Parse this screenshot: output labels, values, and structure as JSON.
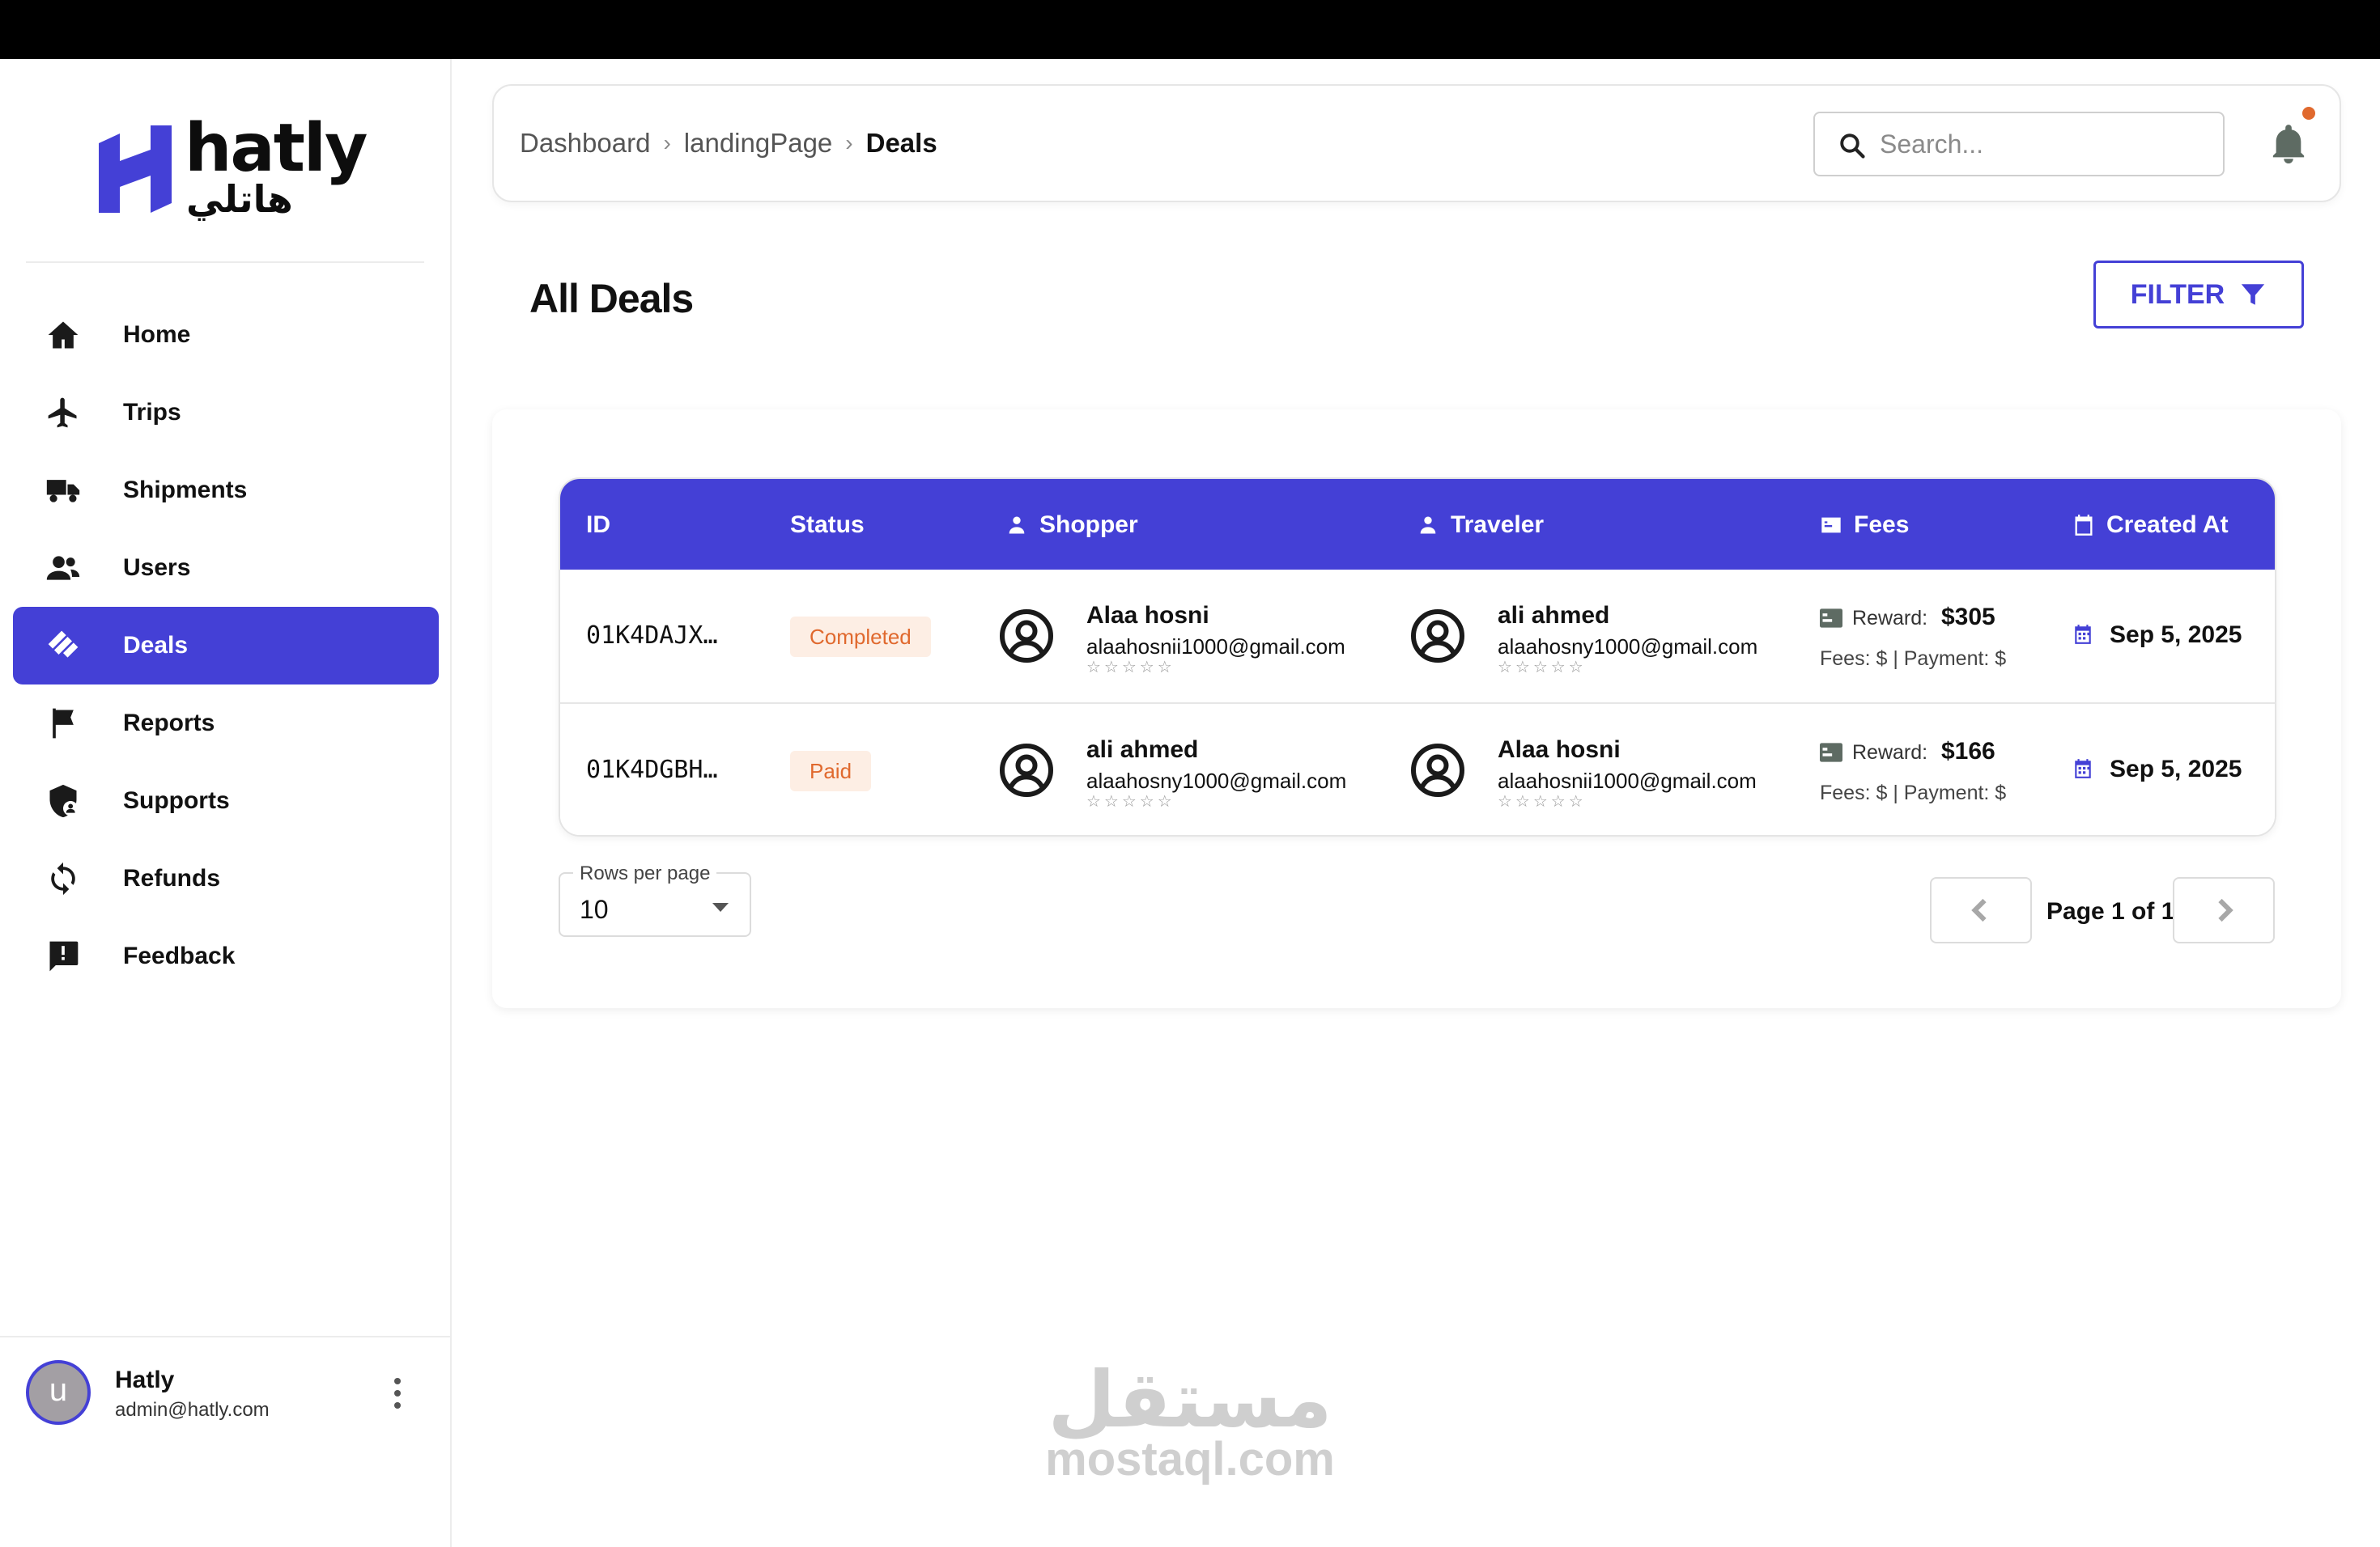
{
  "brand": {
    "name": "hatly",
    "arabic_name": "هاتلي",
    "accent_color": "#4440d6"
  },
  "sidebar": {
    "items": [
      {
        "label": "Home",
        "icon": "home-icon"
      },
      {
        "label": "Trips",
        "icon": "airplane-icon"
      },
      {
        "label": "Shipments",
        "icon": "truck-icon"
      },
      {
        "label": "Users",
        "icon": "users-icon"
      },
      {
        "label": "Deals",
        "icon": "handshake-icon",
        "active": true
      },
      {
        "label": "Reports",
        "icon": "flag-icon"
      },
      {
        "label": "Supports",
        "icon": "shield-user-icon"
      },
      {
        "label": "Refunds",
        "icon": "refresh-icon"
      },
      {
        "label": "Feedback",
        "icon": "feedback-icon"
      }
    ],
    "user": {
      "avatar_letter": "u",
      "name": "Hatly",
      "email": "admin@hatly.com"
    }
  },
  "header": {
    "breadcrumb": [
      "Dashboard",
      "landingPage",
      "Deals"
    ],
    "search_placeholder": "Search...",
    "has_notification": true
  },
  "page": {
    "title": "All Deals",
    "filter_label": "FILTER"
  },
  "table": {
    "columns": [
      "ID",
      "Status",
      "Shopper",
      "Traveler",
      "Fees",
      "Created At"
    ],
    "rows": [
      {
        "id": "01K4DAJX…",
        "status": "Completed",
        "shopper": {
          "name": "Alaa hosni",
          "email": "alaahosnii1000@gmail.com",
          "stars": "☆☆☆☆☆"
        },
        "traveler": {
          "name": "ali ahmed",
          "email": "alaahosny1000@gmail.com",
          "stars": "☆☆☆☆☆"
        },
        "reward_label": "Reward:",
        "reward": "$305",
        "fees_line": "Fees: $ | Payment: $",
        "created_at": "Sep 5, 2025"
      },
      {
        "id": "01K4DGBH…",
        "status": "Paid",
        "shopper": {
          "name": "ali ahmed",
          "email": "alaahosny1000@gmail.com",
          "stars": "☆☆☆☆☆"
        },
        "traveler": {
          "name": "Alaa hosni",
          "email": "alaahosnii1000@gmail.com",
          "stars": "☆☆☆☆☆"
        },
        "reward_label": "Reward:",
        "reward": "$166",
        "fees_line": "Fees: $ | Payment: $",
        "created_at": "Sep 5, 2025"
      }
    ]
  },
  "pagination": {
    "rows_per_page_label": "Rows per page",
    "rows_per_page": "10",
    "page_label": "Page 1 of 1"
  },
  "watermark": {
    "arabic": "مستقل",
    "latin": "mostaql.com"
  }
}
